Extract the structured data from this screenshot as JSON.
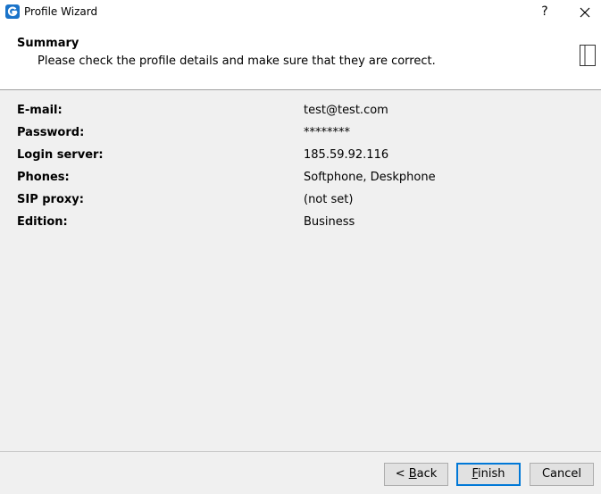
{
  "window": {
    "title": "Profile Wizard",
    "help_label": "?",
    "icon": "app-logo-icon",
    "close_icon": "close-icon"
  },
  "header": {
    "title": "Summary",
    "subtitle": "Please check the profile details and make sure that they are correct.",
    "icon": "side-panel-icon"
  },
  "details": [
    {
      "label": "E-mail:",
      "value": "test@test.com"
    },
    {
      "label": "Password:",
      "value": "********"
    },
    {
      "label": "Login server:",
      "value": "185.59.92.116"
    },
    {
      "label": "Phones:",
      "value": "Softphone, Deskphone"
    },
    {
      "label": "SIP proxy:",
      "value": "(not set)"
    },
    {
      "label": "Edition:",
      "value": "Business"
    }
  ],
  "buttons": {
    "back_prefix": "< ",
    "back_mnemonic": "B",
    "back_rest": "ack",
    "finish_mnemonic": "F",
    "finish_rest": "inish",
    "cancel": "Cancel"
  },
  "colors": {
    "accent": "#0078d7",
    "app_icon": "#1a73c9",
    "background": "#f0f0f0"
  }
}
